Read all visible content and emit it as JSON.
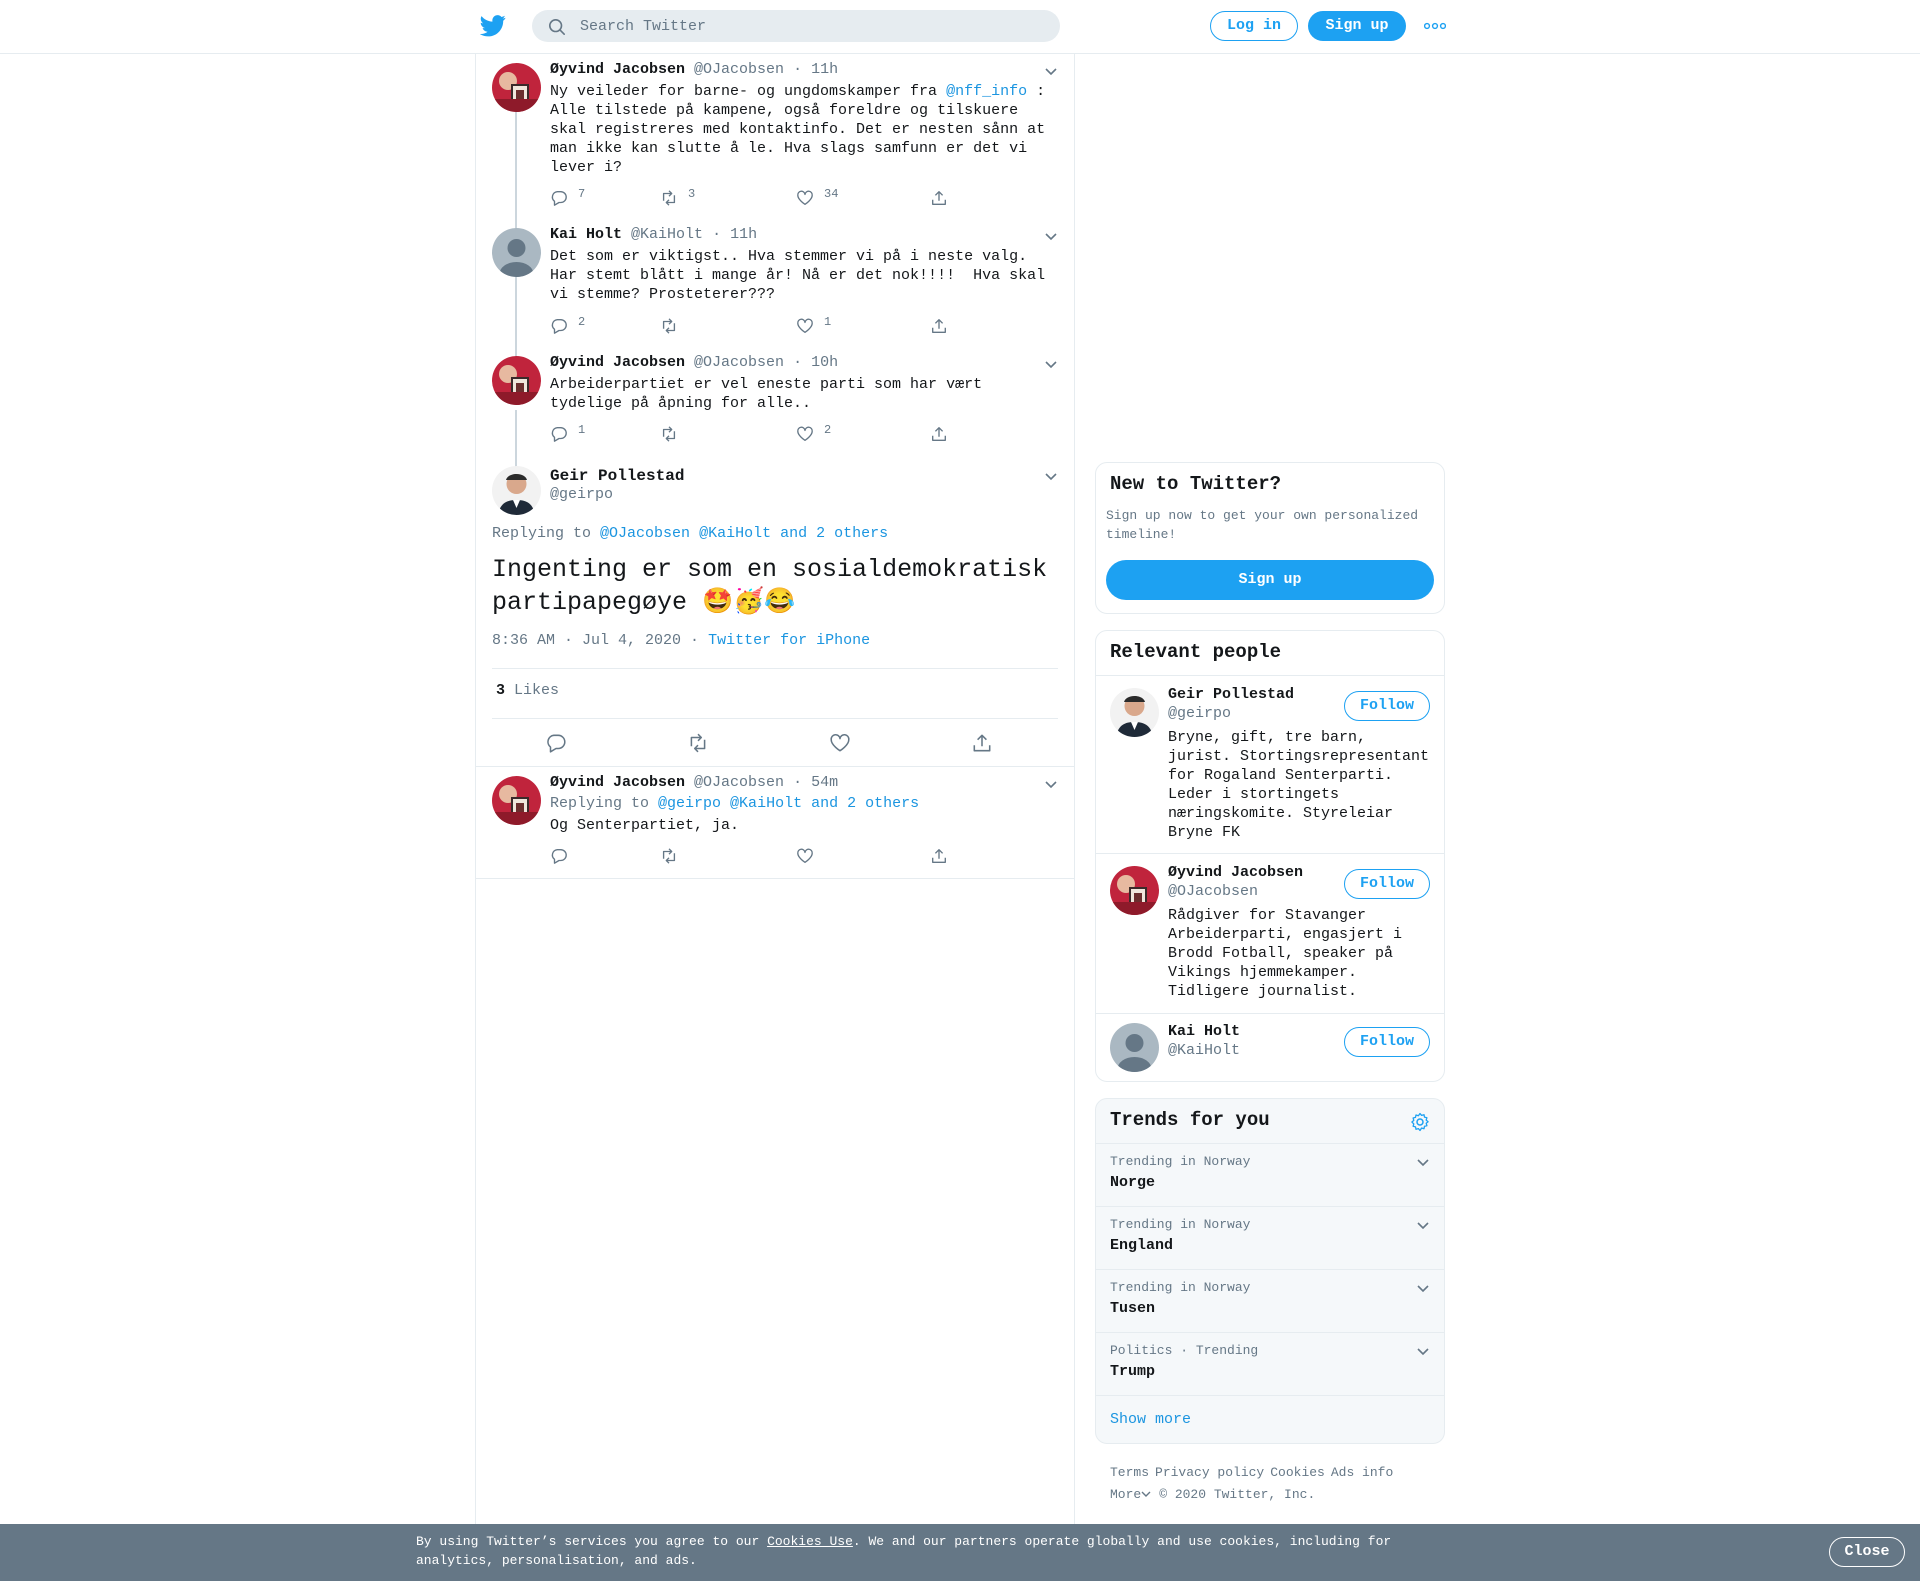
{
  "header": {
    "search_placeholder": "Search Twitter",
    "login_label": "Log in",
    "signup_label": "Sign up"
  },
  "colors": {
    "accent": "#1da1f2",
    "link": "#1b95e0",
    "muted": "#657786",
    "border": "#e6ecf0",
    "cookie_bar": "#657786"
  },
  "thread": [
    {
      "name": "Øyvind Jacobsen",
      "handle": "@OJacobsen",
      "time": "· 11h",
      "text_before": "Ny veileder for barne- og ungdomskamper fra ",
      "mention": "@nff_info",
      "text_after": " : Alle tilstede på kampene, også foreldre og tilskuere skal registreres med kontaktinfo. Det er nesten sånn at man ikke kan slutte å le. Hva slags samfunn er det vi lever i?",
      "replies": "7",
      "retweets": "3",
      "likes": "34"
    },
    {
      "name": "Kai Holt",
      "handle": "@KaiHolt",
      "time": "· 11h",
      "text": "Det som er viktigst.. Hva stemmer vi på i neste valg. Har stemt blått i mange år! Nå er det nok!!!!  Hva skal vi stemme? Prosteterer???",
      "replies": "2",
      "retweets": "",
      "likes": "1"
    },
    {
      "name": "Øyvind Jacobsen",
      "handle": "@OJacobsen",
      "time": "· 10h",
      "text": "Arbeiderpartiet er vel eneste parti som har vært tydelige på åpning for alle..",
      "replies": "1",
      "retweets": "",
      "likes": "2"
    }
  ],
  "main_tweet": {
    "name": "Geir Pollestad",
    "handle": "@geirpo",
    "replying_prefix": "Replying to",
    "replying_to": "@OJacobsen @KaiHolt and 2 others",
    "text": "Ingenting er som en sosialdemokratisk partipapegøye 🤩🥳😂",
    "time": "8:36 AM · Jul 4, 2020",
    "sep": "·",
    "source": "Twitter for iPhone",
    "likes_count": "3",
    "likes_label": "Likes"
  },
  "reply": {
    "name": "Øyvind Jacobsen",
    "handle": "@OJacobsen",
    "time": "· 54m",
    "replying_prefix": "Replying to",
    "replying_to": "@geirpo @KaiHolt and 2 others",
    "text": "Og Senterpartiet, ja."
  },
  "sidebar": {
    "new_to_twitter": {
      "title": "New to Twitter?",
      "subtitle": "Sign up now to get your own personalized timeline!",
      "button": "Sign up"
    },
    "relevant_people": {
      "title": "Relevant people",
      "follow_label": "Follow",
      "people": [
        {
          "name": "Geir Pollestad",
          "handle": "@geirpo",
          "bio": "Bryne, gift, tre barn, jurist. Stortingsrepresentant for Rogaland Senterparti. Leder i stortingets næringskomite. Styreleiar Bryne FK"
        },
        {
          "name": "Øyvind Jacobsen",
          "handle": "@OJacobsen",
          "bio": "Rådgiver for Stavanger Arbeiderparti, engasjert i Brodd Fotball, speaker på Vikings hjemmekamper. Tidligere journalist."
        },
        {
          "name": "Kai Holt",
          "handle": "@KaiHolt",
          "bio": ""
        }
      ]
    },
    "trends": {
      "title": "Trends for you",
      "items": [
        {
          "context": "Trending in Norway",
          "name": "Norge"
        },
        {
          "context": "Trending in Norway",
          "name": "England"
        },
        {
          "context": "Trending in Norway",
          "name": "Tusen"
        },
        {
          "context": "Politics · Trending",
          "name": "Trump"
        }
      ],
      "show_more": "Show more"
    },
    "footer": {
      "links": [
        "Terms",
        "Privacy policy",
        "Cookies",
        "Ads info"
      ],
      "more": "More",
      "copyright": "© 2020 Twitter, Inc."
    }
  },
  "cookie_bar": {
    "text_before": "By using Twitter’s services you agree to our ",
    "link": "Cookies Use",
    "text_after": ". We and our partners operate globally and use cookies, including for analytics, personalisation, and ads.",
    "close": "Close"
  }
}
